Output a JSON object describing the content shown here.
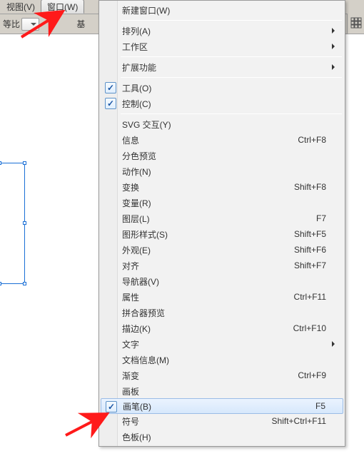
{
  "menubar": {
    "items": [
      {
        "label": "视图(V)",
        "active": false
      },
      {
        "label": "窗口(W)",
        "active": true
      }
    ]
  },
  "toolbar": {
    "ratio_label": "等比",
    "basic_label": "基"
  },
  "dropdown": {
    "groups": [
      [
        {
          "label": "新建窗口(W)"
        }
      ],
      [
        {
          "label": "排列(A)",
          "submenu": true
        },
        {
          "label": "工作区",
          "submenu": true
        }
      ],
      [
        {
          "label": "扩展功能",
          "submenu": true
        }
      ],
      [
        {
          "label": "工具(O)",
          "checked": true
        },
        {
          "label": "控制(C)",
          "checked": true
        }
      ],
      [
        {
          "label": "SVG 交互(Y)"
        },
        {
          "label": "信息",
          "accel": "Ctrl+F8"
        },
        {
          "label": "分色预览"
        },
        {
          "label": "动作(N)"
        },
        {
          "label": "变换",
          "accel": "Shift+F8"
        },
        {
          "label": "变量(R)"
        },
        {
          "label": "图层(L)",
          "accel": "F7"
        },
        {
          "label": "图形样式(S)",
          "accel": "Shift+F5"
        },
        {
          "label": "外观(E)",
          "accel": "Shift+F6"
        },
        {
          "label": "对齐",
          "accel": "Shift+F7"
        },
        {
          "label": "导航器(V)"
        },
        {
          "label": "属性",
          "accel": "Ctrl+F11"
        },
        {
          "label": "拼合器预览"
        },
        {
          "label": "描边(K)",
          "accel": "Ctrl+F10"
        },
        {
          "label": "文字",
          "submenu": true
        },
        {
          "label": "文档信息(M)"
        },
        {
          "label": "渐变",
          "accel": "Ctrl+F9"
        },
        {
          "label": "画板"
        },
        {
          "label": "画笔(B)",
          "accel": "F5",
          "checked": true,
          "highlight": true
        },
        {
          "label": "符号",
          "accel": "Shift+Ctrl+F11"
        },
        {
          "label": "色板(H)"
        }
      ]
    ]
  }
}
